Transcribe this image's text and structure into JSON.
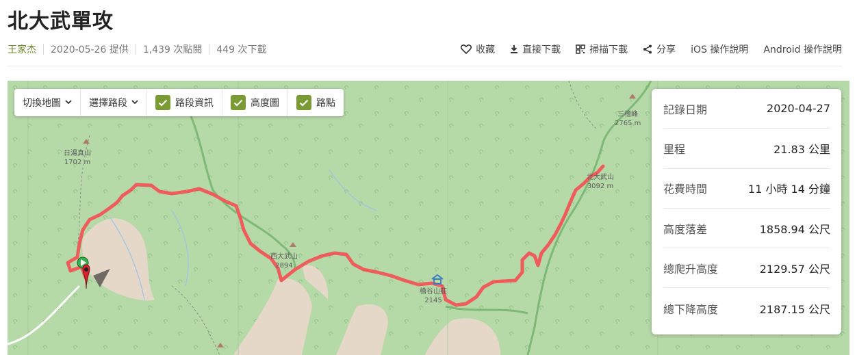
{
  "title": "北大武單攻",
  "meta": {
    "author": "王家杰",
    "provided": "2020-05-26 提供",
    "views": "1,439 次點閱",
    "downloads": "449 次下載"
  },
  "actions": {
    "favorite": "收藏",
    "download": "直接下載",
    "scan": "掃描下載",
    "share": "分享",
    "ios": "iOS 操作說明",
    "android": "Android 操作說明"
  },
  "toolbar": {
    "switch_map": "切換地圖",
    "select_section": "選擇路段",
    "route_info": "路段資訊",
    "elevation": "高度圖",
    "waypoints": "路點"
  },
  "stats": {
    "date_label": "記錄日期",
    "date_value": "2020-04-27",
    "distance_label": "里程",
    "distance_value": "21.83 公里",
    "time_label": "花費時間",
    "time_value": "11 小時 14 分鐘",
    "drop_label": "高度落差",
    "drop_value": "1858.94 公尺",
    "ascent_label": "總爬升高度",
    "ascent_value": "2129.57 公尺",
    "descent_label": "總下降高度",
    "descent_value": "2187.15 公尺"
  },
  "map_labels": {
    "peak1_name": "日湯真山",
    "peak1_elev": "1702 m",
    "peak2_name": "西大武山",
    "peak2_elev": "2894",
    "cabin_name": "檜谷山莊",
    "cabin_elev": "2145",
    "peak3_name": "三檜峰",
    "peak3_elev": "2765 m",
    "peak4_name": "北大武山",
    "peak4_elev": "3092 m"
  },
  "colors": {
    "accent": "#7a9a32",
    "track": "#ef5c5c",
    "map_green": "#b6d9a8"
  }
}
